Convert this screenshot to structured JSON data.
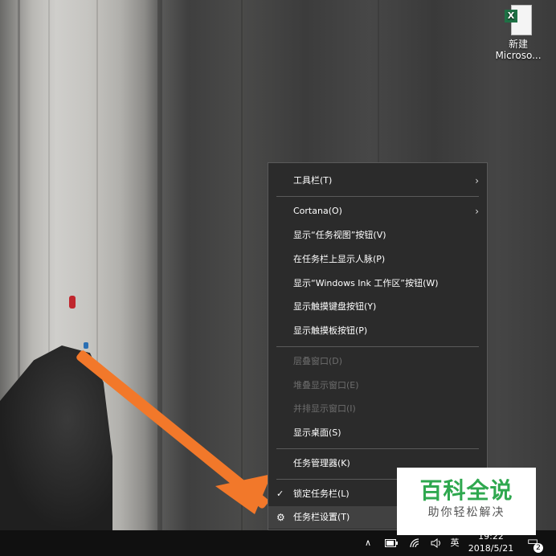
{
  "desktop": {
    "icon_label_line1": "新建",
    "icon_label_line2": "Microso...",
    "icon_badge": "X",
    "icon_type": "excel-file-icon"
  },
  "context_menu": {
    "items": [
      {
        "label": "工具栏(T)",
        "submenu": true
      },
      {
        "label": "Cortana(O)",
        "submenu": true
      },
      {
        "label": "显示“任务视图”按钮(V)"
      },
      {
        "label": "在任务栏上显示人脉(P)"
      },
      {
        "label": "显示“Windows Ink 工作区”按钮(W)"
      },
      {
        "label": "显示触摸键盘按钮(Y)"
      },
      {
        "label": "显示触摸板按钮(P)"
      },
      {
        "label": "层叠窗口(D)",
        "disabled": true
      },
      {
        "label": "堆叠显示窗口(E)",
        "disabled": true
      },
      {
        "label": "并排显示窗口(I)",
        "disabled": true
      },
      {
        "label": "显示桌面(S)"
      },
      {
        "label": "任务管理器(K)"
      },
      {
        "label": "锁定任务栏(L)",
        "checked": true
      },
      {
        "label": "任务栏设置(T)",
        "icon": "gear-icon",
        "highlighted": true
      }
    ],
    "submenu_glyph": "›",
    "check_glyph": "✓",
    "gear_glyph": "⚙"
  },
  "taskbar": {
    "tray_chevron": "∧",
    "ime_label": "英",
    "clock_time": "19:22",
    "clock_date": "2018/5/21",
    "notification_count": "2",
    "icons": [
      "chevron-up-icon",
      "battery-icon",
      "wifi-icon",
      "volume-icon",
      "notification-icon"
    ]
  },
  "watermark": {
    "title": "百科全说",
    "subtitle": "助你轻松解决"
  },
  "colors": {
    "menu_bg": "#2b2b2b",
    "menu_hover": "#414141",
    "arrow": "#f2782a",
    "watermark_green": "#2fa84f",
    "taskbar_bg": "#101010"
  }
}
